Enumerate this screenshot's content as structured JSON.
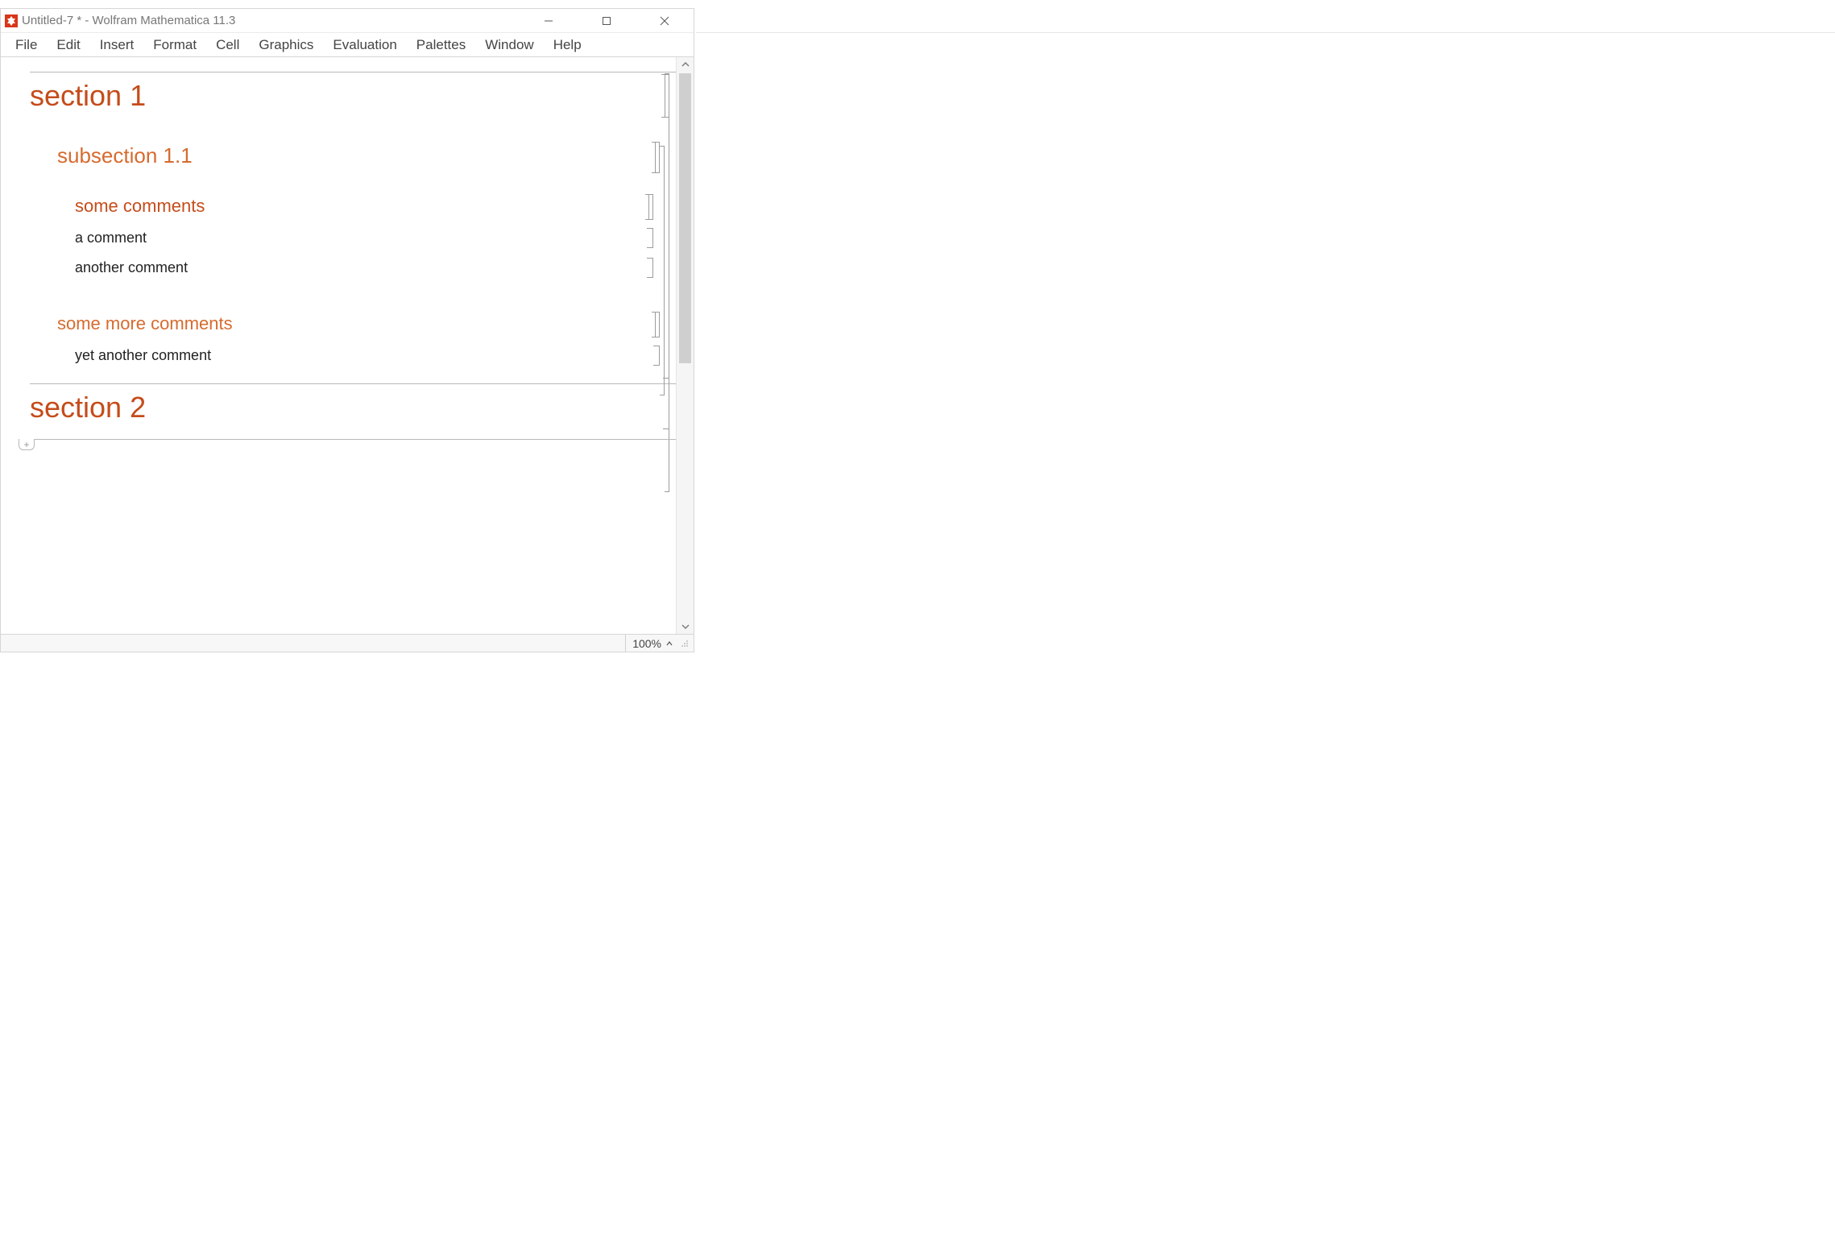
{
  "titlebar": {
    "title": "Untitled-7 * - Wolfram Mathematica 11.3"
  },
  "menu": {
    "items": [
      "File",
      "Edit",
      "Insert",
      "Format",
      "Cell",
      "Graphics",
      "Evaluation",
      "Palettes",
      "Window",
      "Help"
    ]
  },
  "notebook": {
    "section1": "section 1",
    "subsection11": "subsection 1.1",
    "subsub1": "some comments",
    "comment_a": "a comment",
    "comment_b": "another comment",
    "subsub2": "some more comments",
    "comment_c": "yet another comment",
    "section2": "section 2"
  },
  "statusbar": {
    "zoom": "100%"
  }
}
